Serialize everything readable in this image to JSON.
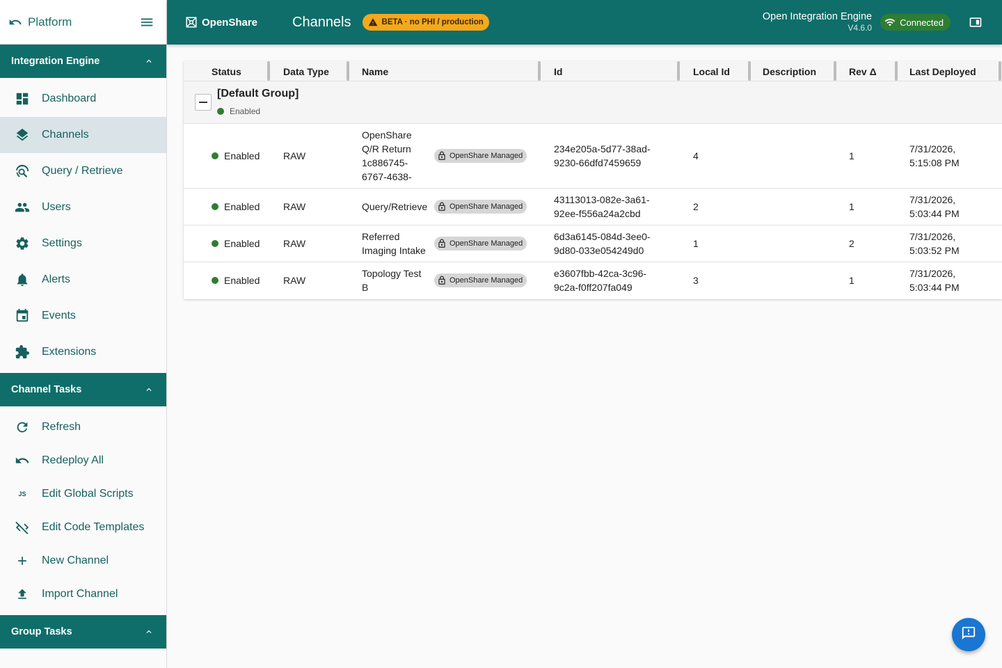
{
  "sidebar": {
    "platform_label": "Platform",
    "sections": {
      "engine": {
        "title": "Integration Engine"
      },
      "channel_tasks": {
        "title": "Channel Tasks"
      },
      "group_tasks": {
        "title": "Group Tasks"
      }
    },
    "nav": [
      {
        "label": "Dashboard",
        "icon": "dashboard-icon"
      },
      {
        "label": "Channels",
        "icon": "layers-icon",
        "active": true
      },
      {
        "label": "Query / Retrieve",
        "icon": "query-retrieve-icon"
      },
      {
        "label": "Users",
        "icon": "users-icon"
      },
      {
        "label": "Settings",
        "icon": "gear-icon"
      },
      {
        "label": "Alerts",
        "icon": "bell-icon"
      },
      {
        "label": "Events",
        "icon": "calendar-icon"
      },
      {
        "label": "Extensions",
        "icon": "puzzle-icon"
      }
    ],
    "tasks": [
      {
        "label": "Refresh",
        "icon": "refresh-icon"
      },
      {
        "label": "Redeploy All",
        "icon": "undo-icon"
      },
      {
        "label": "Edit Global Scripts",
        "icon": "js-icon",
        "icon_text": "JS"
      },
      {
        "label": "Edit Code Templates",
        "icon": "code-off-icon"
      },
      {
        "label": "New Channel",
        "icon": "plus-icon"
      },
      {
        "label": "Import Channel",
        "icon": "upload-icon"
      }
    ]
  },
  "header": {
    "brand": "OpenShare",
    "title": "Channels",
    "beta": "BETA · no PHI / production",
    "engine_name": "Open Integration Engine",
    "engine_version": "V4.6.0",
    "connection": "Connected"
  },
  "table": {
    "columns": [
      "Status",
      "Data Type",
      "Name",
      "Id",
      "Local Id",
      "Description",
      "Rev Δ",
      "Last Deployed"
    ],
    "group": {
      "name": "[Default Group]",
      "status": "Enabled"
    },
    "managed_label": "OpenShare Managed",
    "rows": [
      {
        "status": "Enabled",
        "data_type": "RAW",
        "name": [
          "OpenShare",
          "Q/R Return",
          "1c886745-",
          "6767-4638-"
        ],
        "id": [
          "234e205a-5d77-38ad-",
          "9230-66dfd7459659"
        ],
        "local_id": "4",
        "description": "",
        "rev": "1",
        "deployed": [
          "7/31/2026,",
          "5:15:08 PM"
        ]
      },
      {
        "status": "Enabled",
        "data_type": "RAW",
        "name": [
          "Query/Retrieve"
        ],
        "id": [
          "43113013-082e-3a61-",
          "92ee-f556a24a2cbd"
        ],
        "local_id": "2",
        "description": "",
        "rev": "1",
        "deployed": [
          "7/31/2026,",
          "5:03:44 PM"
        ]
      },
      {
        "status": "Enabled",
        "data_type": "RAW",
        "name": [
          "Referred",
          "Imaging Intake"
        ],
        "id": [
          "6d3a6145-084d-3ee0-",
          "9d80-033e054249d0"
        ],
        "local_id": "1",
        "description": "",
        "rev": "2",
        "deployed": [
          "7/31/2026,",
          "5:03:52 PM"
        ]
      },
      {
        "status": "Enabled",
        "data_type": "RAW",
        "name": [
          "Topology Test",
          "B"
        ],
        "id": [
          "e3607fbb-42ca-3c96-",
          "9c2a-f0ff207fa049"
        ],
        "local_id": "3",
        "description": "",
        "rev": "1",
        "deployed": [
          "7/31/2026,",
          "5:03:44 PM"
        ]
      }
    ]
  },
  "colors": {
    "primary": "#0f6e6a",
    "nav_text": "#16615d",
    "active_bg": "#d9e3e8",
    "beta": "#f4a81d",
    "connected": "#2f7d34",
    "enabled_dot": "#2e7d32",
    "fab": "#1976d2"
  },
  "fab": {
    "icon": "feedback-icon"
  }
}
